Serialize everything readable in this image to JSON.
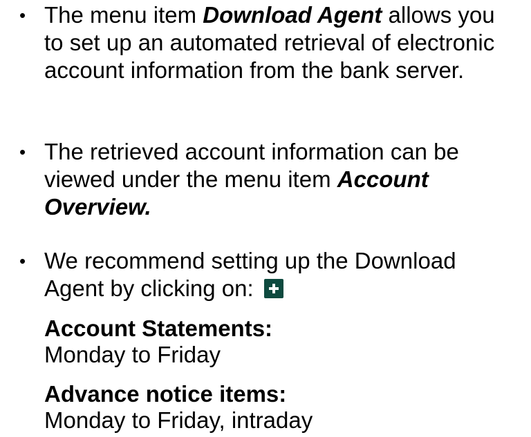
{
  "bullets": [
    {
      "lines": [
        "The menu item ",
        "Download Agent",
        " allows you to set up an automated retrieval of electronic account information from the bank server."
      ]
    },
    {
      "lines": [
        "The retrieved account information can be viewed under the menu item ",
        "Account Overview",
        "."
      ]
    },
    {
      "lines": [
        "We recommend setting up the Download Agent by clicking on: "
      ]
    }
  ],
  "schedules": [
    {
      "heading": "Account Statements:",
      "value": "Monday to Friday"
    },
    {
      "heading": "Advance notice items:",
      "value": "Monday to Friday, intraday"
    }
  ],
  "icons": {
    "bullet": "bullet-dot",
    "add_button": "plus-icon",
    "add_button_color": "#0e4a3f"
  }
}
